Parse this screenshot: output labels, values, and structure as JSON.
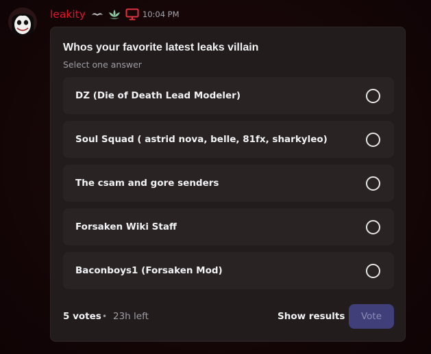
{
  "message": {
    "username": "leakity",
    "username_color": "#e8122b",
    "timestamp": "10:04 PM",
    "badges": [
      "mustache-icon",
      "lotus-icon",
      "desktop-icon"
    ]
  },
  "poll": {
    "question": "Whos your favorite latest leaks villain",
    "hint": "Select one answer",
    "answers": [
      {
        "label": "DZ (Die of Death Lead Modeler)"
      },
      {
        "label": "Soul Squad ( astrid nova, belle, 81fx, sharkyleo)"
      },
      {
        "label": "The csam and gore senders"
      },
      {
        "label": "Forsaken Wiki Staff"
      },
      {
        "label": "Baconboys1 (Forsaken Mod)"
      }
    ],
    "votes": "5 votes",
    "separator": "•",
    "time_left": "23h left",
    "show_results_label": "Show results",
    "vote_label": "Vote"
  },
  "colors": {
    "card_bg": "#221c1d",
    "answer_bg": "#2a2324",
    "vote_button_bg": "#403f7a",
    "desktop_icon": "#e0333f",
    "lotus_icon": "#8fc9a3"
  }
}
